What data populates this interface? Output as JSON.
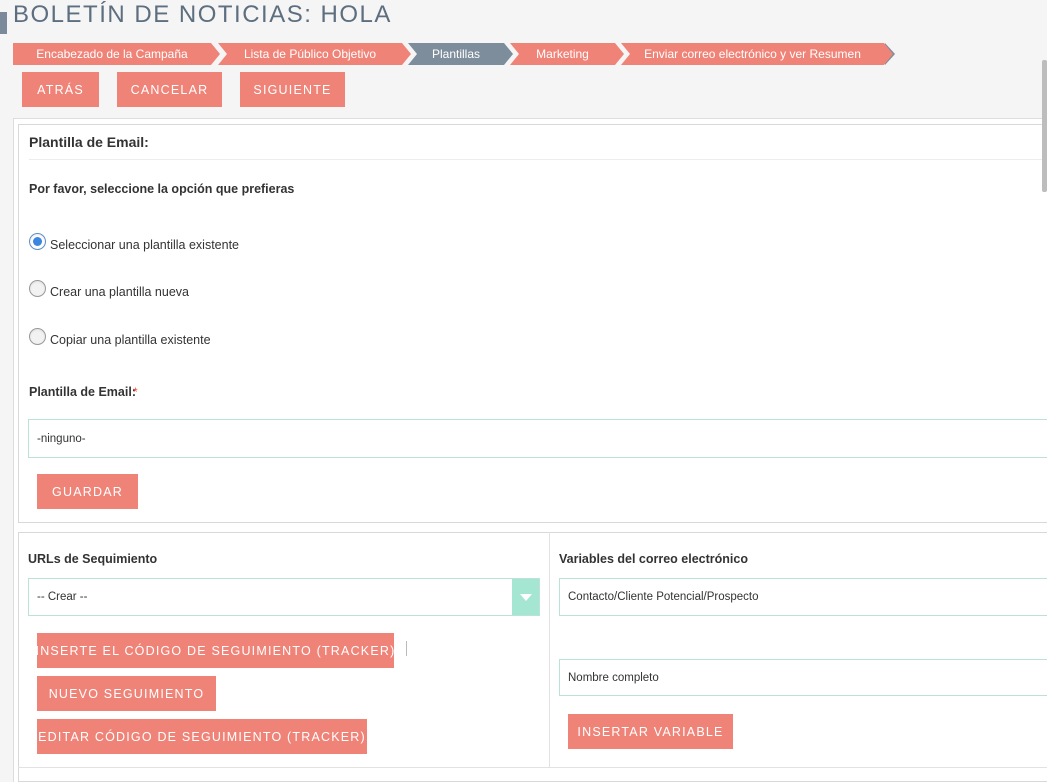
{
  "header": {
    "title": "BOLETÍN DE NOTICIAS: HOLA"
  },
  "wizard": {
    "steps": [
      {
        "label": "Encabezado de la Campaña",
        "state": "done"
      },
      {
        "label": "Lista de Público Objetivo",
        "state": "done"
      },
      {
        "label": "Plantillas",
        "state": "current"
      },
      {
        "label": "Marketing",
        "state": "todo"
      },
      {
        "label": "Enviar correo electrónico y ver Resumen",
        "state": "todo"
      }
    ]
  },
  "toolbar": {
    "back_label": "ATRÁS",
    "cancel_label": "CANCELAR",
    "next_label": "SIGUIENTE"
  },
  "template_panel": {
    "title": "Plantilla de Email:",
    "prompt": "Por favor, seleccione la opción que prefieras",
    "options": [
      {
        "label": "Seleccionar una plantilla existente",
        "checked": true
      },
      {
        "label": "Crear una plantilla nueva",
        "checked": false
      },
      {
        "label": "Copiar una plantilla existente",
        "checked": false
      }
    ],
    "field_label": "Plantilla de Email:",
    "required_mark": "*",
    "field_value": "-ninguno-",
    "save_label": "GUARDAR"
  },
  "tracking": {
    "title": "URLs de Sequimiento",
    "select_value": "-- Crear --",
    "insert_label": "INSERTE EL CÓDIGO DE SEGUIMIENTO (TRACKER)",
    "new_label": "NUEVO SEGUIMIENTO",
    "edit_label": "EDITAR CÓDIGO DE SEGUIMIENTO (TRACKER)"
  },
  "variables": {
    "title": "Variables del correo electrónico",
    "module_value": "Contacto/Cliente Potencial/Prospecto",
    "field_value": "Nombre completo",
    "insert_label": "INSERTAR VARIABLE"
  },
  "colors": {
    "accent": "#f08377",
    "step_done": "#f08377",
    "step_current": "#7d8d9c",
    "field_border": "#b9e3d9",
    "select_caret": "#a5e6d3"
  }
}
